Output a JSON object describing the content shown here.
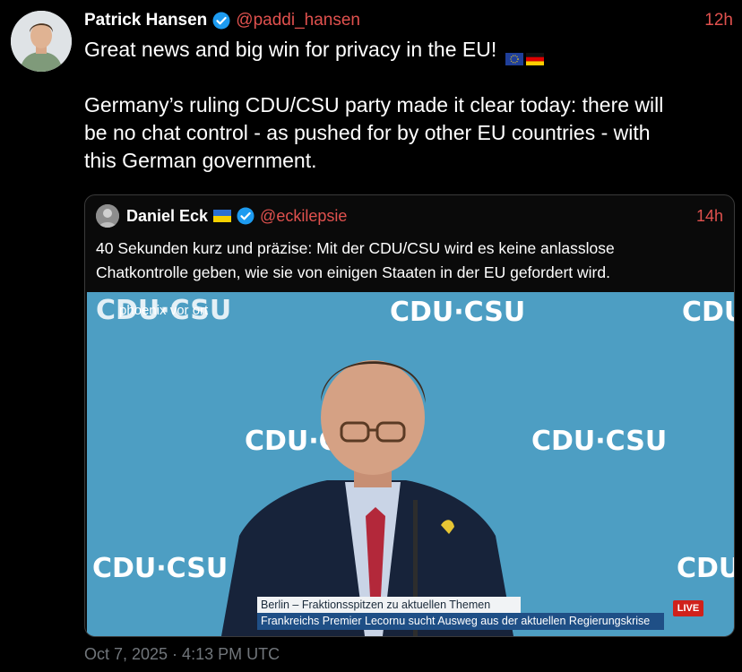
{
  "tweet": {
    "author_name": "Patrick Hansen",
    "handle": "@paddi_hansen",
    "time": "12h",
    "text_line1": "Great news and big win for privacy in the EU!",
    "text_line2": "Germany’s ruling CDU/CSU party made it clear today: there will",
    "text_line3": "be no chat control - as pushed for by other EU countries - with",
    "text_line4": "this German government.",
    "footer": "Oct 7, 2025 · 4:13 PM UTC"
  },
  "quote": {
    "author_name": "Daniel Eck",
    "handle": "@eckilepsie",
    "time": "14h",
    "text_line1": "40 Sekunden kurz und präzise: Mit der CDU/CSU wird es keine anlasslose",
    "text_line2": "Chatkontrolle geben, wie sie von einigen Staaten in der EU gefordert wird."
  },
  "video": {
    "logo_text": "CDU·CSU",
    "channel_name": "phoenix vor ort",
    "lower_third_title": "Berlin – Fraktionsspitzen zu aktuellen Themen",
    "lower_third_ticker": "Frankreichs Premier Lecornu sucht Ausweg aus der aktuellen Regierungskrise",
    "live_badge": "LIVE"
  },
  "colors": {
    "background": "#000000",
    "accent_link": "#e0514e",
    "verified_blue": "#1d9bf0",
    "video_backdrop": "#4d9ec3"
  },
  "icons": [
    "verified-badge-icon",
    "eu-flag-icon",
    "germany-flag-icon",
    "ukraine-flag-icon"
  ]
}
